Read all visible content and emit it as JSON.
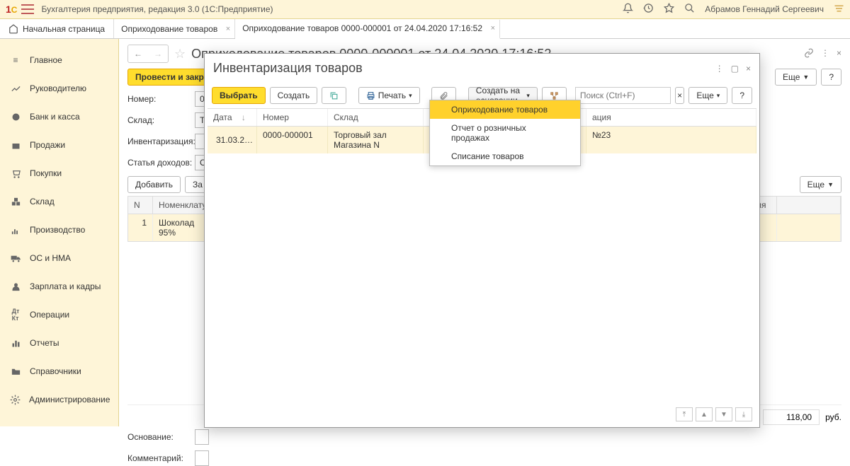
{
  "top": {
    "title": "Бухгалтерия предприятия, редакция 3.0  (1С:Предприятие)",
    "user": "Абрамов Геннадий Сергеевич"
  },
  "tabs": {
    "home": "Начальная страница",
    "items": [
      {
        "label": "Оприходование товаров"
      },
      {
        "label": "Оприходование товаров 0000-000001 от 24.04.2020 17:16:52"
      }
    ]
  },
  "sidebar": [
    "Главное",
    "Руководителю",
    "Банк и касса",
    "Продажи",
    "Покупки",
    "Склад",
    "Производство",
    "ОС и НМА",
    "Зарплата и кадры",
    "Операции",
    "Отчеты",
    "Справочники",
    "Администрирование"
  ],
  "doc": {
    "title": "Оприходование товаров 0000-000001 от 24.04.2020 17:16:52",
    "btn_post_close": "Провести и закрыть",
    "more": "Еще",
    "help": "?",
    "f_number_label": "Номер:",
    "f_number_value": "00",
    "f_warehouse_label": "Склад:",
    "f_warehouse_value": "То",
    "f_inventory_label": "Инвентаризация:",
    "f_income_label": "Статья доходов:",
    "f_income_value": "О",
    "btn_add": "Добавить",
    "btn_fill": "За",
    "grid_cols": [
      "N",
      "Номенклатур"
    ],
    "grid_row": [
      "1",
      "Шоколад 95%"
    ],
    "f_reason_label": "Основание:",
    "f_comment_label": "Комментарий:",
    "total_value": "118,00",
    "total_unit": "руб.",
    "hidden_col": "ения"
  },
  "dialog": {
    "title": "Инвентаризация товаров",
    "btn_select": "Выбрать",
    "btn_create": "Создать",
    "btn_print": "Печать",
    "btn_base": "Создать на основании",
    "search_ph": "Поиск (Ctrl+F)",
    "more": "Еще",
    "help": "?",
    "cols": {
      "date": "Дата",
      "sort": "↓",
      "number": "Номер",
      "warehouse": "Склад",
      "org": "ация"
    },
    "row": {
      "date": "31.03.2…",
      "number": "0000-000001",
      "warehouse": "Торговый зал Магазина N",
      "org": " №23"
    },
    "menu": [
      "Оприходование товаров",
      "Отчет о розничных продажах",
      "Списание товаров"
    ]
  }
}
